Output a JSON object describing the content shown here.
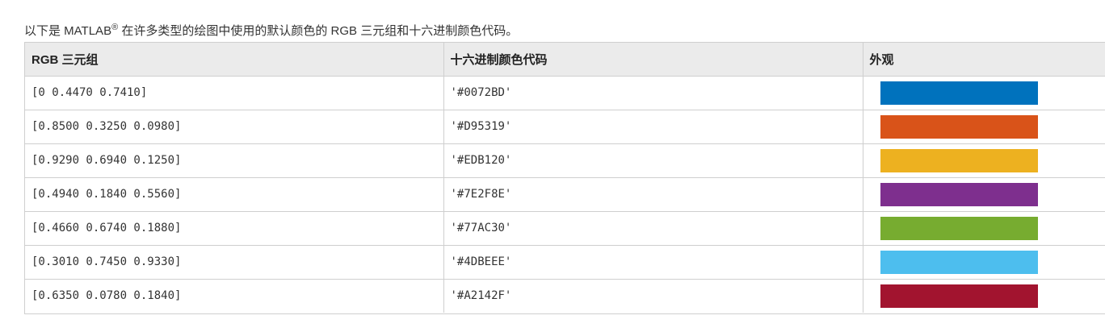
{
  "intro": {
    "before": "以下是 MATLAB",
    "registered": "®",
    "after": " 在许多类型的绘图中使用的默认颜色的 RGB 三元组和十六进制颜色代码。"
  },
  "table": {
    "headers": [
      "RGB 三元组",
      "十六进制颜色代码",
      "外观"
    ],
    "rows": [
      {
        "rgb": "[0 0.4470 0.7410]",
        "hex": "'#0072BD'",
        "color": "#0072BD"
      },
      {
        "rgb": "[0.8500 0.3250 0.0980]",
        "hex": "'#D95319'",
        "color": "#D95319"
      },
      {
        "rgb": "[0.9290 0.6940 0.1250]",
        "hex": "'#EDB120'",
        "color": "#EDB120"
      },
      {
        "rgb": "[0.4940 0.1840 0.5560]",
        "hex": "'#7E2F8E'",
        "color": "#7E2F8E"
      },
      {
        "rgb": "[0.4660 0.6740 0.1880]",
        "hex": "'#77AC30'",
        "color": "#77AC30"
      },
      {
        "rgb": "[0.3010 0.7450 0.9330]",
        "hex": "'#4DBEEE'",
        "color": "#4DBEEE"
      },
      {
        "rgb": "[0.6350 0.0780 0.1840]",
        "hex": "'#A2142F'",
        "color": "#A2142F"
      }
    ]
  }
}
